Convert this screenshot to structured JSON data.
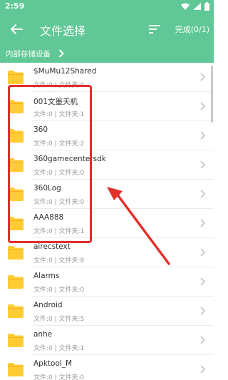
{
  "status": {
    "time": "2:59"
  },
  "header": {
    "title": "文件选择",
    "done_label": "完成(0/1)"
  },
  "path": {
    "label": "内部存储设备"
  },
  "colors": {
    "accent": "#5fc896",
    "folder": "#ffcc33",
    "highlight": "#e0302a"
  },
  "files": [
    {
      "name": "$MuMu12Shared",
      "meta": "文件:0 | 文件夹:0"
    },
    {
      "name": "001文墨天机",
      "meta": "文件:0 | 文件夹:1"
    },
    {
      "name": "360",
      "meta": "文件:0 | 文件夹:2"
    },
    {
      "name": "360gamecentersdk",
      "meta": "文件:0 | 文件夹:0"
    },
    {
      "name": "360Log",
      "meta": "文件:0 | 文件夹:0"
    },
    {
      "name": "AAA888",
      "meta": "文件:0 | 文件夹:1"
    },
    {
      "name": "airecstext",
      "meta": "文件:0 | 文件夹:8"
    },
    {
      "name": "Alarms",
      "meta": "文件:0 | 文件夹:0"
    },
    {
      "name": "Android",
      "meta": "文件:0 | 文件夹:5"
    },
    {
      "name": "anhe",
      "meta": "文件:0 | 文件夹:1"
    },
    {
      "name": "Apktool_M",
      "meta": "文件:0 | 文件夹:0"
    }
  ]
}
